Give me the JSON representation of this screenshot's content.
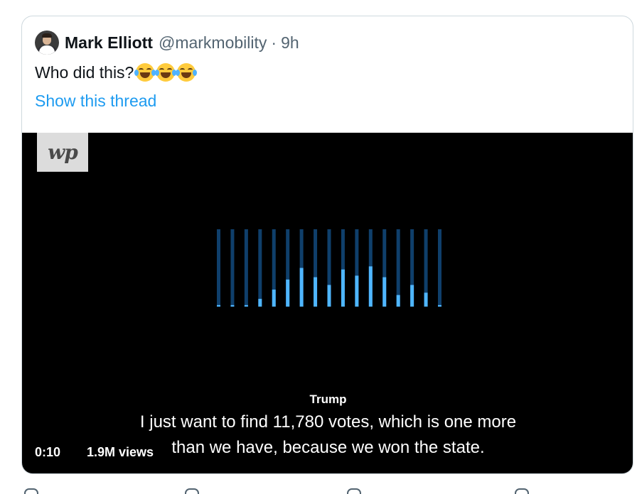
{
  "tweet": {
    "author_name": "Mark Elliott",
    "author_handle": "@markmobility",
    "separator": "·",
    "time": "9h",
    "text": "Who did this?",
    "emojis": [
      "face-with-tears-of-joy",
      "face-with-tears-of-joy",
      "face-with-tears-of-joy"
    ],
    "thread_link": "Show this thread"
  },
  "video": {
    "logo_text": "wp",
    "speaker": "Trump",
    "caption_line1": "I just want to find 11,780 votes, which is one more",
    "caption_line2": "than we have, because we won the state.",
    "timestamp": "0:10",
    "views": "1.9M views",
    "visualizer_levels": [
      0.02,
      0.02,
      0.02,
      0.1,
      0.22,
      0.35,
      0.5,
      0.38,
      0.28,
      0.48,
      0.4,
      0.52,
      0.38,
      0.15,
      0.28,
      0.18,
      0.02
    ]
  },
  "colors": {
    "link": "#1d9bf0",
    "secondary_text": "#536471",
    "border": "#cfd9de",
    "visualizer_active": "#4fb6ff",
    "visualizer_track": "#0f3f6b"
  }
}
